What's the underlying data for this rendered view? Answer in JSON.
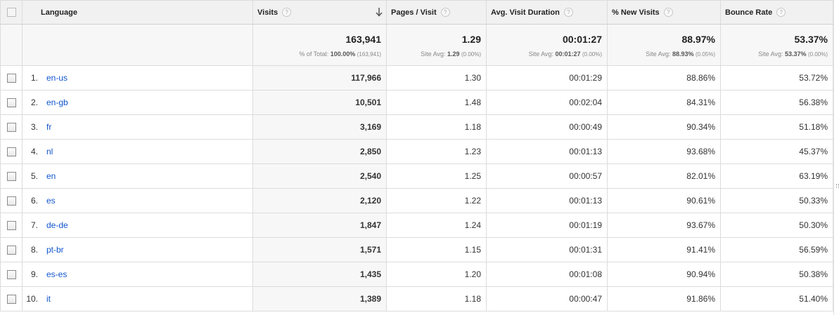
{
  "header": {
    "dimension": "Language",
    "columns": [
      "Visits",
      "Pages / Visit",
      "Avg. Visit Duration",
      "% New Visits",
      "Bounce Rate"
    ],
    "help_glyph": "?",
    "sorted_column": "Visits",
    "sort_icon": "down-arrow-icon"
  },
  "totals": {
    "visits": "163,941",
    "visits_sub_label": "% of Total:",
    "visits_sub_value": "100.00%",
    "visits_sub_extra": "(163,941)",
    "pages": "1.29",
    "pages_sub_label": "Site Avg:",
    "pages_sub_value": "1.29",
    "pages_sub_extra": "(0.00%)",
    "duration": "00:01:27",
    "duration_sub_label": "Site Avg:",
    "duration_sub_value": "00:01:27",
    "duration_sub_extra": "(0.00%)",
    "new_visits": "88.97%",
    "new_visits_sub_label": "Site Avg:",
    "new_visits_sub_value": "88.93%",
    "new_visits_sub_extra": "(0.05%)",
    "bounce": "53.37%",
    "bounce_sub_label": "Site Avg:",
    "bounce_sub_value": "53.37%",
    "bounce_sub_extra": "(0.00%)"
  },
  "rows": [
    {
      "idx": "1.",
      "lang": "en-us",
      "visits": "117,966",
      "pages": "1.30",
      "duration": "00:01:29",
      "new_visits": "88.86%",
      "bounce": "53.72%"
    },
    {
      "idx": "2.",
      "lang": "en-gb",
      "visits": "10,501",
      "pages": "1.48",
      "duration": "00:02:04",
      "new_visits": "84.31%",
      "bounce": "56.38%"
    },
    {
      "idx": "3.",
      "lang": "fr",
      "visits": "3,169",
      "pages": "1.18",
      "duration": "00:00:49",
      "new_visits": "90.34%",
      "bounce": "51.18%"
    },
    {
      "idx": "4.",
      "lang": "nl",
      "visits": "2,850",
      "pages": "1.23",
      "duration": "00:01:13",
      "new_visits": "93.68%",
      "bounce": "45.37%"
    },
    {
      "idx": "5.",
      "lang": "en",
      "visits": "2,540",
      "pages": "1.25",
      "duration": "00:00:57",
      "new_visits": "82.01%",
      "bounce": "63.19%"
    },
    {
      "idx": "6.",
      "lang": "es",
      "visits": "2,120",
      "pages": "1.22",
      "duration": "00:01:13",
      "new_visits": "90.61%",
      "bounce": "50.33%"
    },
    {
      "idx": "7.",
      "lang": "de-de",
      "visits": "1,847",
      "pages": "1.24",
      "duration": "00:01:19",
      "new_visits": "93.67%",
      "bounce": "50.30%"
    },
    {
      "idx": "8.",
      "lang": "pt-br",
      "visits": "1,571",
      "pages": "1.15",
      "duration": "00:01:31",
      "new_visits": "91.41%",
      "bounce": "56.59%"
    },
    {
      "idx": "9.",
      "lang": "es-es",
      "visits": "1,435",
      "pages": "1.20",
      "duration": "00:01:08",
      "new_visits": "90.94%",
      "bounce": "50.38%"
    },
    {
      "idx": "10.",
      "lang": "it",
      "visits": "1,389",
      "pages": "1.18",
      "duration": "00:00:47",
      "new_visits": "91.86%",
      "bounce": "51.40%"
    }
  ],
  "colors": {
    "link": "#1155cc",
    "header_bg": "#f1f1f1",
    "sorted_column_bg": "#f7f7f7",
    "border": "#dcdcdc"
  }
}
